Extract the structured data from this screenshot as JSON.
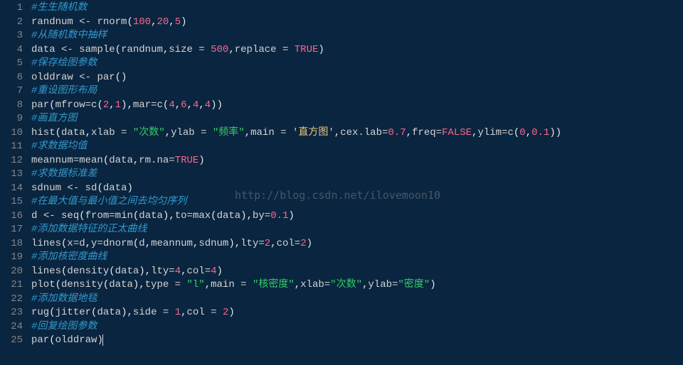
{
  "watermark": "http://blog.csdn.net/ilovemoon10",
  "gutter": [
    "1",
    "2",
    "3",
    "4",
    "5",
    "6",
    "7",
    "8",
    "9",
    "10",
    "11",
    "12",
    "13",
    "14",
    "15",
    "16",
    "17",
    "18",
    "19",
    "20",
    "21",
    "22",
    "23",
    "24",
    "25"
  ],
  "lines": [
    {
      "tokens": [
        {
          "c": "t-cmt",
          "t": "#生生随机数"
        }
      ]
    },
    {
      "tokens": [
        {
          "c": "t-id",
          "t": "randnum "
        },
        {
          "c": "t-op",
          "t": "<- "
        },
        {
          "c": "t-fn",
          "t": "rnorm"
        },
        {
          "c": "t-pun",
          "t": "("
        },
        {
          "c": "t-num",
          "t": "100"
        },
        {
          "c": "t-pun",
          "t": ","
        },
        {
          "c": "t-num",
          "t": "20"
        },
        {
          "c": "t-pun",
          "t": ","
        },
        {
          "c": "t-num",
          "t": "5"
        },
        {
          "c": "t-pun",
          "t": ")"
        }
      ]
    },
    {
      "tokens": [
        {
          "c": "t-cmt",
          "t": "#从随机数中抽样"
        }
      ]
    },
    {
      "tokens": [
        {
          "c": "t-id",
          "t": "data "
        },
        {
          "c": "t-op",
          "t": "<- "
        },
        {
          "c": "t-fn",
          "t": "sample"
        },
        {
          "c": "t-pun",
          "t": "("
        },
        {
          "c": "t-id",
          "t": "randnum"
        },
        {
          "c": "t-pun",
          "t": ","
        },
        {
          "c": "t-par",
          "t": "size "
        },
        {
          "c": "t-op",
          "t": "= "
        },
        {
          "c": "t-num",
          "t": "500"
        },
        {
          "c": "t-pun",
          "t": ","
        },
        {
          "c": "t-par",
          "t": "replace "
        },
        {
          "c": "t-op",
          "t": "= "
        },
        {
          "c": "t-kw",
          "t": "TRUE"
        },
        {
          "c": "t-pun",
          "t": ")"
        }
      ]
    },
    {
      "tokens": [
        {
          "c": "t-cmt",
          "t": "#保存绘图参数"
        }
      ]
    },
    {
      "tokens": [
        {
          "c": "t-id",
          "t": "olddraw "
        },
        {
          "c": "t-op",
          "t": "<- "
        },
        {
          "c": "t-fn",
          "t": "par"
        },
        {
          "c": "t-pun",
          "t": "()"
        }
      ]
    },
    {
      "tokens": [
        {
          "c": "t-cmt",
          "t": "#重设图形布局"
        }
      ]
    },
    {
      "tokens": [
        {
          "c": "t-fn",
          "t": "par"
        },
        {
          "c": "t-pun",
          "t": "("
        },
        {
          "c": "t-par",
          "t": "mfrow"
        },
        {
          "c": "t-op",
          "t": "="
        },
        {
          "c": "t-fn",
          "t": "c"
        },
        {
          "c": "t-pun",
          "t": "("
        },
        {
          "c": "t-num",
          "t": "2"
        },
        {
          "c": "t-pun",
          "t": ","
        },
        {
          "c": "t-num",
          "t": "1"
        },
        {
          "c": "t-pun",
          "t": ")"
        },
        {
          "c": "t-pun",
          "t": ","
        },
        {
          "c": "t-par",
          "t": "mar"
        },
        {
          "c": "t-op",
          "t": "="
        },
        {
          "c": "t-fn",
          "t": "c"
        },
        {
          "c": "t-pun",
          "t": "("
        },
        {
          "c": "t-num",
          "t": "4"
        },
        {
          "c": "t-pun",
          "t": ","
        },
        {
          "c": "t-num",
          "t": "6"
        },
        {
          "c": "t-pun",
          "t": ","
        },
        {
          "c": "t-num",
          "t": "4"
        },
        {
          "c": "t-pun",
          "t": ","
        },
        {
          "c": "t-num",
          "t": "4"
        },
        {
          "c": "t-pun",
          "t": "))"
        }
      ]
    },
    {
      "tokens": [
        {
          "c": "t-cmt",
          "t": "#画直方图"
        }
      ]
    },
    {
      "tokens": [
        {
          "c": "t-fn",
          "t": "hist"
        },
        {
          "c": "t-pun",
          "t": "("
        },
        {
          "c": "t-id",
          "t": "data"
        },
        {
          "c": "t-pun",
          "t": ","
        },
        {
          "c": "t-par",
          "t": "xlab "
        },
        {
          "c": "t-op",
          "t": "= "
        },
        {
          "c": "t-str",
          "t": "\"次数\""
        },
        {
          "c": "t-pun",
          "t": ","
        },
        {
          "c": "t-par",
          "t": "ylab "
        },
        {
          "c": "t-op",
          "t": "= "
        },
        {
          "c": "t-str",
          "t": "\"频率\""
        },
        {
          "c": "t-pun",
          "t": ","
        },
        {
          "c": "t-par",
          "t": "main "
        },
        {
          "c": "t-op",
          "t": "= "
        },
        {
          "c": "t-str2",
          "t": "'直方图'"
        },
        {
          "c": "t-pun",
          "t": ","
        },
        {
          "c": "t-par",
          "t": "cex.lab"
        },
        {
          "c": "t-op",
          "t": "="
        },
        {
          "c": "t-num",
          "t": "0.7"
        },
        {
          "c": "t-pun",
          "t": ","
        },
        {
          "c": "t-par",
          "t": "freq"
        },
        {
          "c": "t-op",
          "t": "="
        },
        {
          "c": "t-kw",
          "t": "FALSE"
        },
        {
          "c": "t-pun",
          "t": ","
        },
        {
          "c": "t-par",
          "t": "ylim"
        },
        {
          "c": "t-op",
          "t": "="
        },
        {
          "c": "t-fn",
          "t": "c"
        },
        {
          "c": "t-pun",
          "t": "("
        },
        {
          "c": "t-num",
          "t": "0"
        },
        {
          "c": "t-pun",
          "t": ","
        },
        {
          "c": "t-num",
          "t": "0.1"
        },
        {
          "c": "t-pun",
          "t": "))"
        }
      ]
    },
    {
      "tokens": [
        {
          "c": "t-cmt",
          "t": "#求数据均值"
        }
      ]
    },
    {
      "tokens": [
        {
          "c": "t-id",
          "t": "meannum"
        },
        {
          "c": "t-op",
          "t": "="
        },
        {
          "c": "t-fn",
          "t": "mean"
        },
        {
          "c": "t-pun",
          "t": "("
        },
        {
          "c": "t-id",
          "t": "data"
        },
        {
          "c": "t-pun",
          "t": ","
        },
        {
          "c": "t-par",
          "t": "rm.na"
        },
        {
          "c": "t-op",
          "t": "="
        },
        {
          "c": "t-kw",
          "t": "TRUE"
        },
        {
          "c": "t-pun",
          "t": ")"
        }
      ]
    },
    {
      "tokens": [
        {
          "c": "t-cmt",
          "t": "#求数据标准差"
        }
      ]
    },
    {
      "tokens": [
        {
          "c": "t-id",
          "t": "sdnum "
        },
        {
          "c": "t-op",
          "t": "<- "
        },
        {
          "c": "t-fn",
          "t": "sd"
        },
        {
          "c": "t-pun",
          "t": "("
        },
        {
          "c": "t-id",
          "t": "data"
        },
        {
          "c": "t-pun",
          "t": ")"
        }
      ]
    },
    {
      "tokens": [
        {
          "c": "t-cmt",
          "t": "#在最大值与最小值之间去均匀序列"
        }
      ]
    },
    {
      "tokens": [
        {
          "c": "t-id",
          "t": "d "
        },
        {
          "c": "t-op",
          "t": "<- "
        },
        {
          "c": "t-fn",
          "t": "seq"
        },
        {
          "c": "t-pun",
          "t": "("
        },
        {
          "c": "t-par",
          "t": "from"
        },
        {
          "c": "t-op",
          "t": "="
        },
        {
          "c": "t-fn",
          "t": "min"
        },
        {
          "c": "t-pun",
          "t": "("
        },
        {
          "c": "t-id",
          "t": "data"
        },
        {
          "c": "t-pun",
          "t": ")"
        },
        {
          "c": "t-pun",
          "t": ","
        },
        {
          "c": "t-par",
          "t": "to"
        },
        {
          "c": "t-op",
          "t": "="
        },
        {
          "c": "t-fn",
          "t": "max"
        },
        {
          "c": "t-pun",
          "t": "("
        },
        {
          "c": "t-id",
          "t": "data"
        },
        {
          "c": "t-pun",
          "t": ")"
        },
        {
          "c": "t-pun",
          "t": ","
        },
        {
          "c": "t-par",
          "t": "by"
        },
        {
          "c": "t-op",
          "t": "="
        },
        {
          "c": "t-num",
          "t": "0.1"
        },
        {
          "c": "t-pun",
          "t": ")"
        }
      ]
    },
    {
      "tokens": [
        {
          "c": "t-cmt",
          "t": "#添加数据特征的正太曲线"
        }
      ]
    },
    {
      "tokens": [
        {
          "c": "t-fn",
          "t": "lines"
        },
        {
          "c": "t-pun",
          "t": "("
        },
        {
          "c": "t-par",
          "t": "x"
        },
        {
          "c": "t-op",
          "t": "="
        },
        {
          "c": "t-id",
          "t": "d"
        },
        {
          "c": "t-pun",
          "t": ","
        },
        {
          "c": "t-par",
          "t": "y"
        },
        {
          "c": "t-op",
          "t": "="
        },
        {
          "c": "t-fn",
          "t": "dnorm"
        },
        {
          "c": "t-pun",
          "t": "("
        },
        {
          "c": "t-id",
          "t": "d"
        },
        {
          "c": "t-pun",
          "t": ","
        },
        {
          "c": "t-id",
          "t": "meannum"
        },
        {
          "c": "t-pun",
          "t": ","
        },
        {
          "c": "t-id",
          "t": "sdnum"
        },
        {
          "c": "t-pun",
          "t": ")"
        },
        {
          "c": "t-pun",
          "t": ","
        },
        {
          "c": "t-par",
          "t": "lty"
        },
        {
          "c": "t-op",
          "t": "="
        },
        {
          "c": "t-num",
          "t": "2"
        },
        {
          "c": "t-pun",
          "t": ","
        },
        {
          "c": "t-par",
          "t": "col"
        },
        {
          "c": "t-op",
          "t": "="
        },
        {
          "c": "t-num",
          "t": "2"
        },
        {
          "c": "t-pun",
          "t": ")"
        }
      ]
    },
    {
      "tokens": [
        {
          "c": "t-cmt",
          "t": "#添加核密度曲线"
        }
      ]
    },
    {
      "tokens": [
        {
          "c": "t-fn",
          "t": "lines"
        },
        {
          "c": "t-pun",
          "t": "("
        },
        {
          "c": "t-fn",
          "t": "density"
        },
        {
          "c": "t-pun",
          "t": "("
        },
        {
          "c": "t-id",
          "t": "data"
        },
        {
          "c": "t-pun",
          "t": ")"
        },
        {
          "c": "t-pun",
          "t": ","
        },
        {
          "c": "t-par",
          "t": "lty"
        },
        {
          "c": "t-op",
          "t": "="
        },
        {
          "c": "t-num",
          "t": "4"
        },
        {
          "c": "t-pun",
          "t": ","
        },
        {
          "c": "t-par",
          "t": "col"
        },
        {
          "c": "t-op",
          "t": "="
        },
        {
          "c": "t-num",
          "t": "4"
        },
        {
          "c": "t-pun",
          "t": ")"
        }
      ]
    },
    {
      "tokens": [
        {
          "c": "t-fn",
          "t": "plot"
        },
        {
          "c": "t-pun",
          "t": "("
        },
        {
          "c": "t-fn",
          "t": "density"
        },
        {
          "c": "t-pun",
          "t": "("
        },
        {
          "c": "t-id",
          "t": "data"
        },
        {
          "c": "t-pun",
          "t": ")"
        },
        {
          "c": "t-pun",
          "t": ","
        },
        {
          "c": "t-par",
          "t": "type "
        },
        {
          "c": "t-op",
          "t": "= "
        },
        {
          "c": "t-str",
          "t": "\"l\""
        },
        {
          "c": "t-pun",
          "t": ","
        },
        {
          "c": "t-par",
          "t": "main "
        },
        {
          "c": "t-op",
          "t": "= "
        },
        {
          "c": "t-str",
          "t": "\"核密度\""
        },
        {
          "c": "t-pun",
          "t": ","
        },
        {
          "c": "t-par",
          "t": "xlab"
        },
        {
          "c": "t-op",
          "t": "="
        },
        {
          "c": "t-str",
          "t": "\"次数\""
        },
        {
          "c": "t-pun",
          "t": ","
        },
        {
          "c": "t-par",
          "t": "ylab"
        },
        {
          "c": "t-op",
          "t": "="
        },
        {
          "c": "t-str",
          "t": "\"密度\""
        },
        {
          "c": "t-pun",
          "t": ")"
        }
      ]
    },
    {
      "tokens": [
        {
          "c": "t-cmt",
          "t": "#添加数据地毯"
        }
      ]
    },
    {
      "tokens": [
        {
          "c": "t-fn",
          "t": "rug"
        },
        {
          "c": "t-pun",
          "t": "("
        },
        {
          "c": "t-fn",
          "t": "jitter"
        },
        {
          "c": "t-pun",
          "t": "("
        },
        {
          "c": "t-id",
          "t": "data"
        },
        {
          "c": "t-pun",
          "t": ")"
        },
        {
          "c": "t-pun",
          "t": ","
        },
        {
          "c": "t-par",
          "t": "side "
        },
        {
          "c": "t-op",
          "t": "= "
        },
        {
          "c": "t-num",
          "t": "1"
        },
        {
          "c": "t-pun",
          "t": ","
        },
        {
          "c": "t-par",
          "t": "col "
        },
        {
          "c": "t-op",
          "t": "= "
        },
        {
          "c": "t-num",
          "t": "2"
        },
        {
          "c": "t-pun",
          "t": ")"
        }
      ]
    },
    {
      "tokens": [
        {
          "c": "t-cmt",
          "t": "#回复绘图参数"
        }
      ]
    },
    {
      "tokens": [
        {
          "c": "t-fn",
          "t": "par"
        },
        {
          "c": "t-pun",
          "t": "("
        },
        {
          "c": "t-id",
          "t": "olddraw"
        },
        {
          "c": "t-pun",
          "t": ")"
        }
      ],
      "cursor": true
    }
  ]
}
